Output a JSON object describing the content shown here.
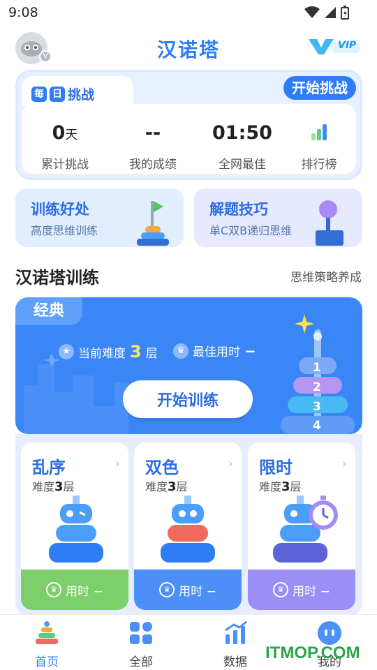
{
  "status_bar": {
    "time": "9:08"
  },
  "header": {
    "title": "汉诺塔",
    "avatar_badge": "V",
    "vip_label": "VIP"
  },
  "daily": {
    "chip_mei": "每",
    "chip_ri": "日",
    "title": "挑战",
    "start_label": "开始挑战",
    "stats": [
      {
        "value": "0",
        "unit": "天",
        "label": "累计挑战"
      },
      {
        "value": "--",
        "unit": "",
        "label": "我的成绩"
      },
      {
        "value": "01:50",
        "unit": "",
        "label": "全网最佳"
      },
      {
        "value": "",
        "unit": "",
        "label": "排行榜"
      }
    ]
  },
  "tips": [
    {
      "title": "训练好处",
      "subtitle": "高度思维训练"
    },
    {
      "title": "解题技巧",
      "subtitle": "单C双B递归思维"
    }
  ],
  "section": {
    "title": "汉诺塔训练",
    "subtitle": "思维策略养成"
  },
  "classic": {
    "tag": "经典",
    "difficulty_prefix": "当前难度",
    "difficulty_value": "3",
    "difficulty_suffix": "层",
    "best_prefix": "最佳用时",
    "best_value": "−",
    "train_label": "开始训练",
    "ring_labels": [
      "1",
      "2",
      "3",
      "4"
    ]
  },
  "modes": [
    {
      "title": "乱序",
      "diff_prefix": "难度",
      "diff_value": "3",
      "diff_suffix": "层",
      "footer": "用时 −",
      "color": "#7ccf6a"
    },
    {
      "title": "双色",
      "diff_prefix": "难度",
      "diff_value": "3",
      "diff_suffix": "层",
      "footer": "用时 −",
      "color": "#4b8ff7"
    },
    {
      "title": "限时",
      "diff_prefix": "难度",
      "diff_value": "3",
      "diff_suffix": "层",
      "footer": "用时 −",
      "color": "#9b8ef5"
    }
  ],
  "nav": [
    {
      "label": "首页",
      "active": true
    },
    {
      "label": "全部",
      "active": false
    },
    {
      "label": "数据",
      "active": false
    },
    {
      "label": "我的",
      "active": false
    }
  ],
  "watermark": "ITMOP.COM",
  "colors": {
    "accent": "#2f7df6",
    "accent_dark": "#2d6de0",
    "tray": "#e8ecff"
  }
}
